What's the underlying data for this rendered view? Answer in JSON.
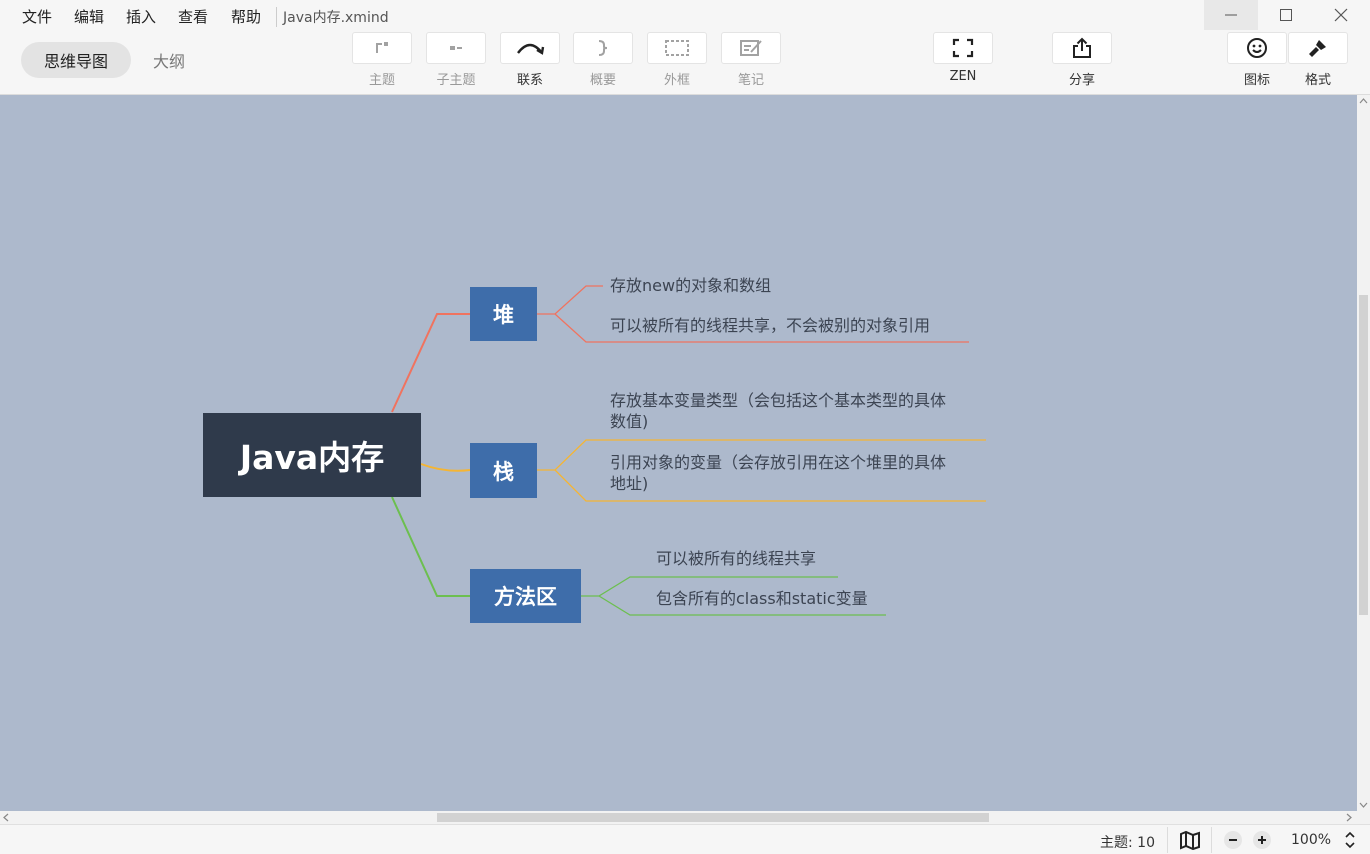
{
  "menu": {
    "file": "文件",
    "edit": "编辑",
    "insert": "插入",
    "view": "查看",
    "help": "帮助",
    "doc_title": "Java内存.xmind"
  },
  "view_tabs": {
    "mindmap": "思维导图",
    "outline": "大纲"
  },
  "toolbar": {
    "topic": "主题",
    "subtopic": "子主题",
    "relationship": "联系",
    "summary": "概要",
    "boundary": "外框",
    "note": "笔记",
    "zen": "ZEN",
    "share": "分享",
    "icon": "图标",
    "format": "格式"
  },
  "mindmap": {
    "root": "Java内存",
    "branches": [
      {
        "label": "堆",
        "color": "#f0735f",
        "items": [
          "存放new的对象和数组",
          "可以被所有的线程共享，不会被别的对象引用"
        ]
      },
      {
        "label": "栈",
        "color": "#f5b533",
        "items": [
          [
            "存放基本变量类型（会包括这个基本类型的具体",
            "数值)"
          ],
          [
            "引用对象的变量（会存放引用在这个堆里的具体",
            "地址)"
          ]
        ]
      },
      {
        "label": "方法区",
        "color": "#6cbf4f",
        "items": [
          "可以被所有的线程共享",
          "包含所有的class和static变量"
        ]
      }
    ],
    "root_color": "#2f3a4b",
    "node_color": "#3e6daa",
    "canvas_color": "#adb9cc"
  },
  "status": {
    "topic_count": "主题: 10",
    "zoom": "100%"
  }
}
